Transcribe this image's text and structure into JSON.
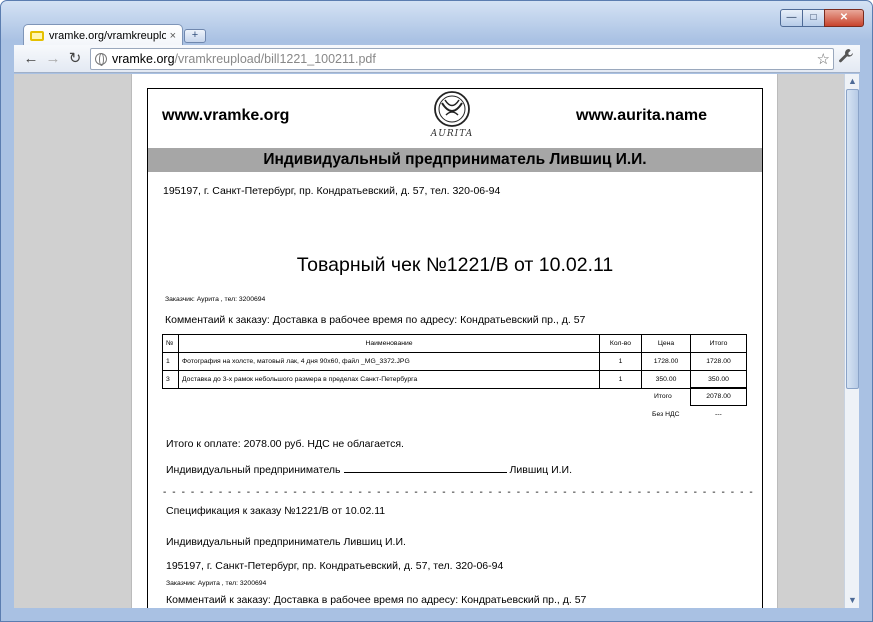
{
  "browser": {
    "tab_title": "vramke.org/vramkreupload...",
    "tab_close": "×",
    "new_tab": "+",
    "url_host": "vramke.org",
    "url_path": "/vramkreupload/bill1221_100211.pdf",
    "controls": {
      "minimize": "—",
      "maximize": "□",
      "close": "✕"
    },
    "nav": {
      "back": "←",
      "forward": "→",
      "reload": "↻",
      "star": "☆",
      "wrench": "🔧"
    }
  },
  "document": {
    "site_left": "www.vramke.org",
    "site_right": "www.aurita.name",
    "logo_text": "AURITA",
    "header_band": "Индивидуальный предприниматель Лившиц И.И.",
    "address": "195197, г. Санкт-Петербург, пр. Кондратьевский, д. 57, тел. 320-06-94",
    "receipt_title": "Товарный чек №1221/В от 10.02.11",
    "customer": "Заказчик: Аурита , тел: 3200694",
    "comment": "Комментаий к заказу: Доставка в рабочее время по адресу: Кондратьевский пр., д. 57",
    "table": {
      "headers": [
        "№",
        "Наименование",
        "Кол-во",
        "Цена",
        "Итого"
      ],
      "rows": [
        [
          "1",
          "Фотография на холсте, матовый лак, 4 дня 90x60, файл _MG_3372.JPG",
          "1",
          "1728.00",
          "1728.00"
        ],
        [
          "3",
          "Доставка до 3-х рамок небольшого размера в пределах Санкт-Петербурга",
          "1",
          "350.00",
          "350.00"
        ]
      ]
    },
    "sum_label": "Итого",
    "sum_value": "2078.00",
    "vat_label": "Без НДС",
    "vat_value": "---",
    "total_text": "Итого к оплате:  2078.00 руб. НДС не облагается.",
    "sign_prefix": "Индивидуальный предприниматель",
    "sign_suffix": "Лившиц И.И.",
    "cut_line": "- - - - - - - - - - - - - - - - - - - - - - - - - - - - - - - - - - - - - - - - - - - - - - - - - - - - - - - - - - - - - - - -",
    "spec_title": "Спецификация к заказу №1221/В от 10.02.11",
    "ip2": "Индивидуальный предприниматель Лившиц И.И.",
    "address2": "195197, г. Санкт-Петербург, пр. Кондратьевский, д. 57, тел. 320-06-94",
    "customer2": "Заказчик: Аурита , тел: 3200694",
    "comment2": "Комментаий к заказу: Доставка в рабочее время по адресу: Кондратьевский пр., д. 57"
  }
}
